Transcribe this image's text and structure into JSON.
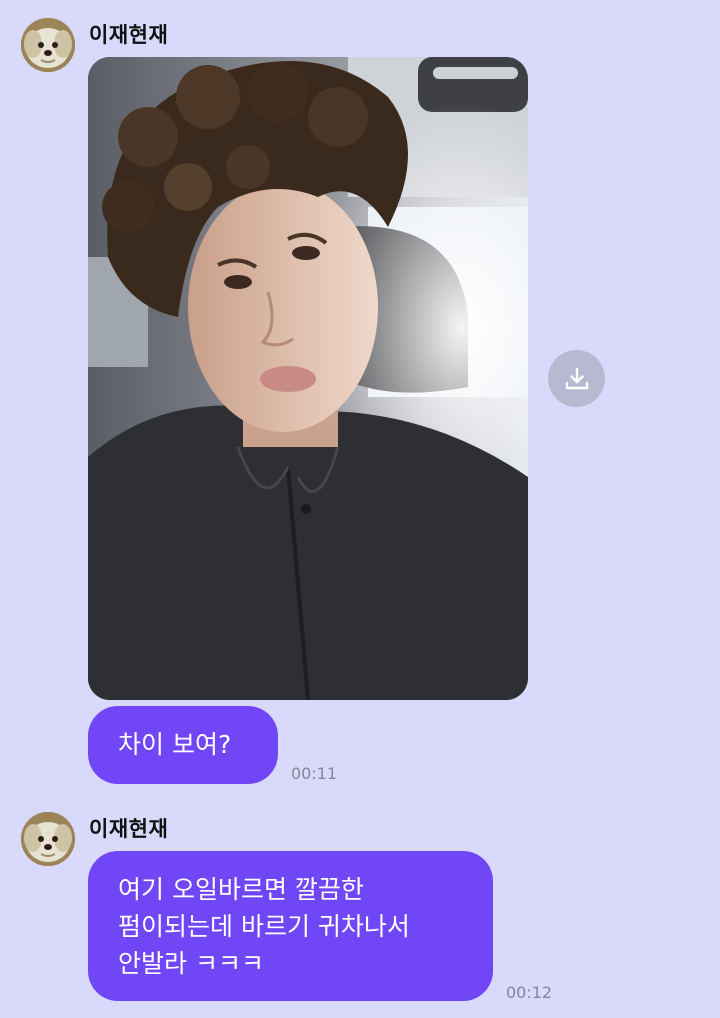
{
  "messages": [
    {
      "sender": "이재현재",
      "avatar_icon": "puppy-avatar-icon",
      "photo": {
        "description_icon": "selfie-photo",
        "download_icon": "download-icon"
      },
      "text": "차이 보여?",
      "time": "00:11"
    },
    {
      "sender": "이재현재",
      "avatar_icon": "puppy-avatar-icon",
      "text": "여기 오일바르면 깔끔한\n펌이되는데 바르기 귀차나서\n안발라 ㅋㅋㅋ",
      "time": "00:12"
    }
  ],
  "colors": {
    "background": "#d9d9fb",
    "bubble": "#7046f6",
    "bubble_text": "#ffffff",
    "timestamp": "#858596",
    "download_button": "#b8b8d2"
  }
}
